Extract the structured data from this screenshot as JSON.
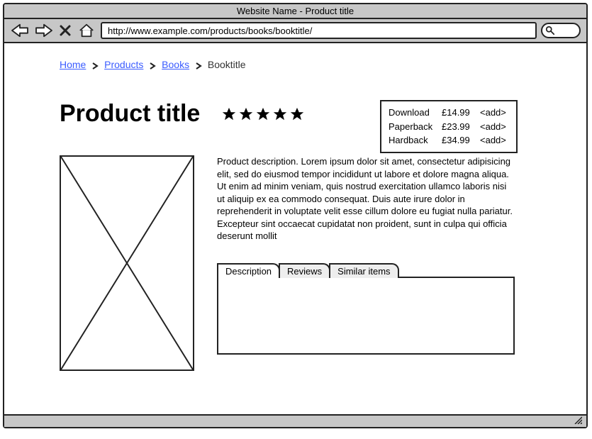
{
  "window_title": "Website Name - Product title",
  "url": "http://www.example.com/products/books/booktitle/",
  "breadcrumbs": {
    "items": [
      {
        "label": "Home",
        "link": true
      },
      {
        "label": "Products",
        "link": true
      },
      {
        "label": "Books",
        "link": true
      },
      {
        "label": "Booktitle",
        "link": false
      }
    ]
  },
  "product": {
    "title": "Product title",
    "rating": 5
  },
  "prices": [
    {
      "name": "Download",
      "price": "£14.99",
      "action": "<add>"
    },
    {
      "name": "Paperback",
      "price": "£23.99",
      "action": "<add>"
    },
    {
      "name": "Hardback",
      "price": "£34.99",
      "action": "<add>"
    }
  ],
  "description": "Product description. Lorem ipsum dolor sit amet, consectetur adipisicing elit, sed do eiusmod tempor incididunt ut labore et dolore magna aliqua. Ut enim ad minim veniam, quis nostrud exercitation ullamco laboris nisi ut aliquip ex ea commodo consequat. Duis aute irure dolor in reprehenderit in voluptate velit esse cillum dolore eu fugiat nulla pariatur. Excepteur sint occaecat cupidatat non proident, sunt in culpa qui officia deserunt mollit",
  "tabs": {
    "items": [
      {
        "label": "Description",
        "active": true
      },
      {
        "label": "Reviews",
        "active": false
      },
      {
        "label": "Similar items",
        "active": false
      }
    ]
  }
}
